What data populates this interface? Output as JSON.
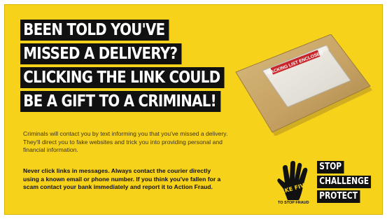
{
  "headline": [
    "BEEN TOLD YOU'VE",
    "MISSED A DELIVERY?",
    "CLICKING THE LINK COULD",
    "BE A GIFT TO A CRIMINAL!"
  ],
  "body_text": "Criminals will contact you by text informing you that you've missed a delivery. They'll direct you to fake websites and trick you into providing personal and financial information.",
  "bold_text": "Never click links in messages. Always contact the courier directly using a known email or phone number. If you think you've fallen for a scam contact your bank immediately and report it to Action Fraud.",
  "package_label": "PACKING LIST ENCLOSED",
  "brand": {
    "logo_text": "TAKE FIVE",
    "logo_subtext": "TO STOP FRAUD",
    "slogan": [
      "STOP",
      "CHALLENGE",
      "PROTECT"
    ]
  },
  "colors": {
    "background": "#f7d21a",
    "block": "#111111",
    "package": "#c9a86a"
  }
}
